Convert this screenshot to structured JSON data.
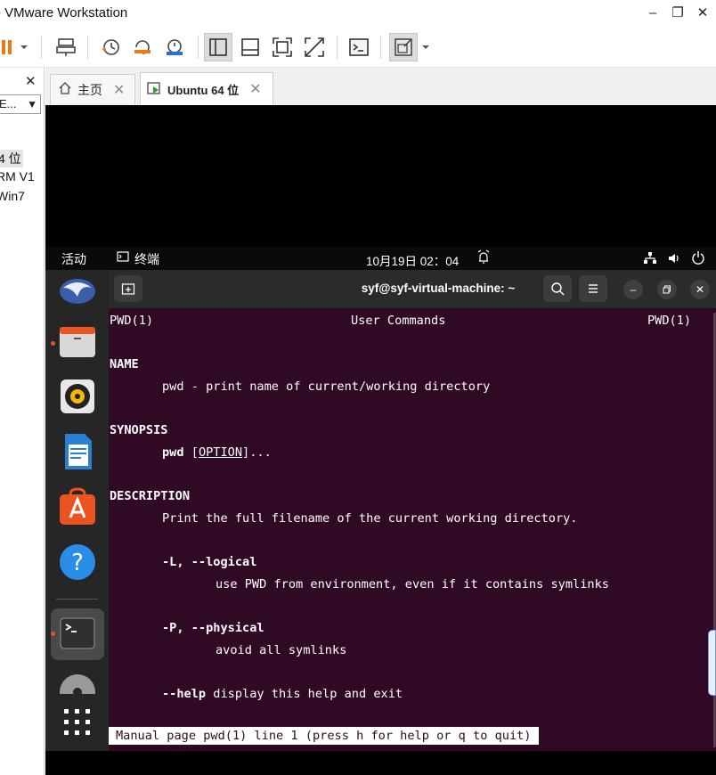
{
  "window": {
    "title": "- VMware Workstation",
    "minimize_glyph": "–",
    "restore_glyph": "❐",
    "close_glyph": "✕"
  },
  "library": {
    "close_glyph": "✕",
    "select_value": "E...",
    "items": [
      "4 位",
      "RM V1",
      "Win7"
    ]
  },
  "tabs": [
    {
      "label": "主页",
      "active": false
    },
    {
      "label": "Ubuntu 64 位",
      "active": true
    }
  ],
  "gnome": {
    "activities": "活动",
    "app_name": "终端",
    "clock": "10月19日 02：04"
  },
  "terminal": {
    "title": "syf@syf-virtual-machine: ~",
    "lines": {
      "header_left": "PWD(1)",
      "header_center": "User Commands",
      "header_right": "PWD(1)",
      "name_heading": "NAME",
      "name_text": "pwd - print name of current/working directory",
      "synopsis_heading": "SYNOPSIS",
      "synopsis_cmd": "pwd",
      "synopsis_open": "[",
      "synopsis_option": "OPTION",
      "synopsis_close": "]...",
      "description_heading": "DESCRIPTION",
      "description_text": "Print the full filename of the current working directory.",
      "logical_opt": "-L, --logical",
      "logical_text": "use PWD from environment, even if it contains symlinks",
      "physical_opt": "-P, --physical",
      "physical_text": "avoid all symlinks",
      "help_opt": "--help",
      "help_text": " display this help and exit"
    },
    "status": "Manual page pwd(1) line 1 (press h for help or q to quit)"
  },
  "colors": {
    "terminal_bg": "#300a24",
    "accent_orange": "#e95420",
    "toolbar_orange": "#f07a12"
  }
}
